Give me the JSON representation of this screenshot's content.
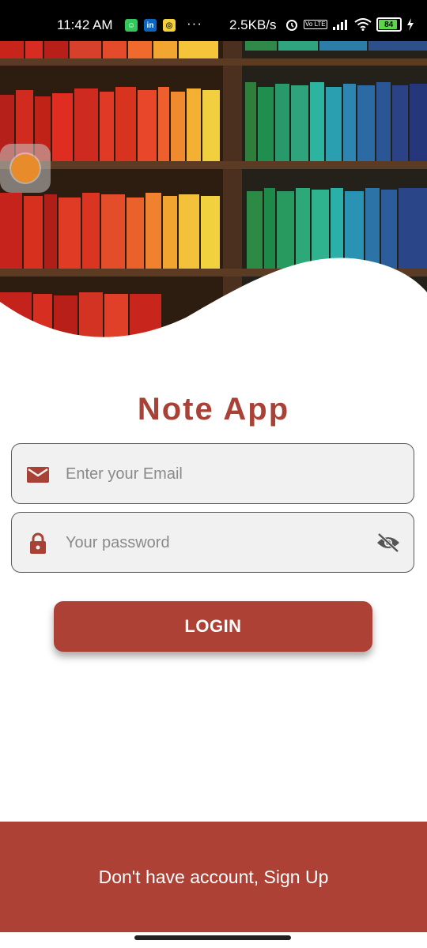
{
  "status_bar": {
    "time": "11:42 AM",
    "dots": "···",
    "speed": "2.5KB/s",
    "battery": "84",
    "icons": [
      "messages-app-icon",
      "linkedin-icon",
      "app-notification-icon",
      "alarm-icon",
      "volte-icon",
      "signal-icon",
      "wifi-icon",
      "battery-icon",
      "charging-icon"
    ],
    "linkedin_label": "in",
    "volte_label": "Vo LTE"
  },
  "app": {
    "title": "Note App",
    "brand_color": "#ad4135"
  },
  "form": {
    "email_placeholder": "Enter your Email",
    "password_placeholder": "Your password",
    "login_label": "LOGIN"
  },
  "footer": {
    "signup_text": "Don't have account, Sign Up"
  }
}
